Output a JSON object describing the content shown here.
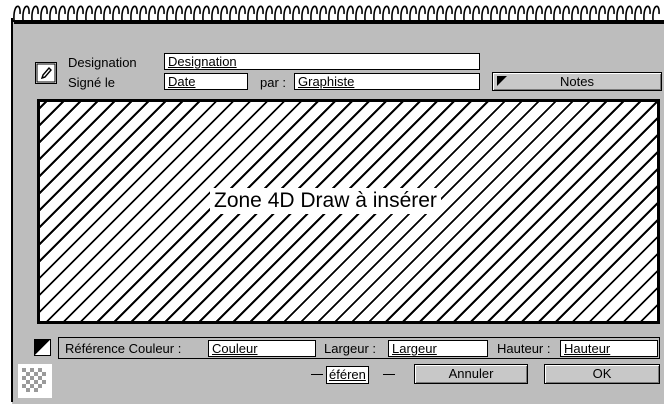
{
  "form": {
    "designation_label": "Designation",
    "designation_value": "Designation",
    "signe_label": "Signé le",
    "date_value": "Date",
    "par_label": "par :",
    "graphiste_value": "Graphiste",
    "notes_button": "Notes"
  },
  "zone": {
    "label": "Zone 4D Draw à insérer"
  },
  "footer": {
    "ref_couleur_label": "Référence Couleur :",
    "couleur_value": "Couleur",
    "largeur_label": "Largeur :",
    "largeur_value": "Largeur",
    "hauteur_label": "Hauteur :",
    "hauteur_value": "Hauteur",
    "reference_text": "éféren",
    "annuler_button": "Annuler",
    "ok_button": "OK"
  }
}
